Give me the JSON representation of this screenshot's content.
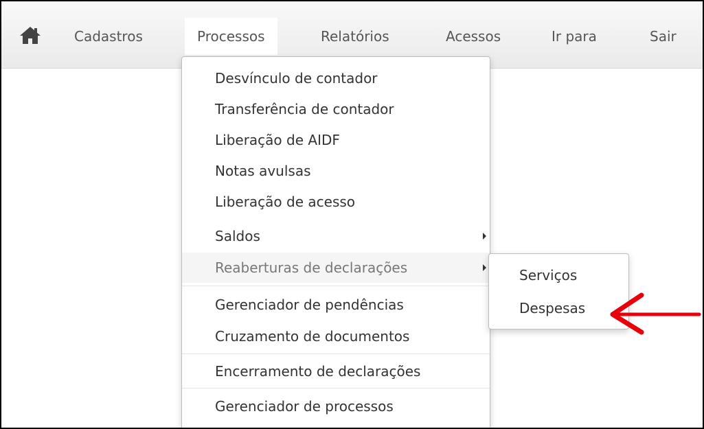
{
  "nav": {
    "items": [
      {
        "label": "Cadastros"
      },
      {
        "label": "Processos"
      },
      {
        "label": "Relatórios"
      },
      {
        "label": "Acessos"
      },
      {
        "label": "Ir para"
      },
      {
        "label": "Sair"
      }
    ],
    "home_icon": "home-icon",
    "active_item": "Processos"
  },
  "processos_menu": {
    "items": [
      {
        "label": "Desvínculo de contador"
      },
      {
        "label": "Transferência de contador"
      },
      {
        "label": "Liberação de AIDF"
      },
      {
        "label": "Notas avulsas"
      },
      {
        "label": "Liberação de acesso"
      },
      {
        "label": "Saldos"
      },
      {
        "label": "Reaberturas de declarações"
      },
      {
        "label": "Gerenciador de pendências"
      },
      {
        "label": "Cruzamento de documentos"
      },
      {
        "label": "Encerramento de declarações"
      },
      {
        "label": "Gerenciador de processos"
      }
    ],
    "hovered_item": "Reaberturas de declarações"
  },
  "reaberturas_submenu": {
    "items": [
      {
        "label": "Serviços"
      },
      {
        "label": "Despesas"
      }
    ]
  },
  "annotation": {
    "arrow_color": "#e8000b",
    "points_to": "Despesas"
  },
  "colors": {
    "nav_text": "#555555",
    "menu_text": "#333333",
    "hover_bg": "#f5f5f5"
  }
}
